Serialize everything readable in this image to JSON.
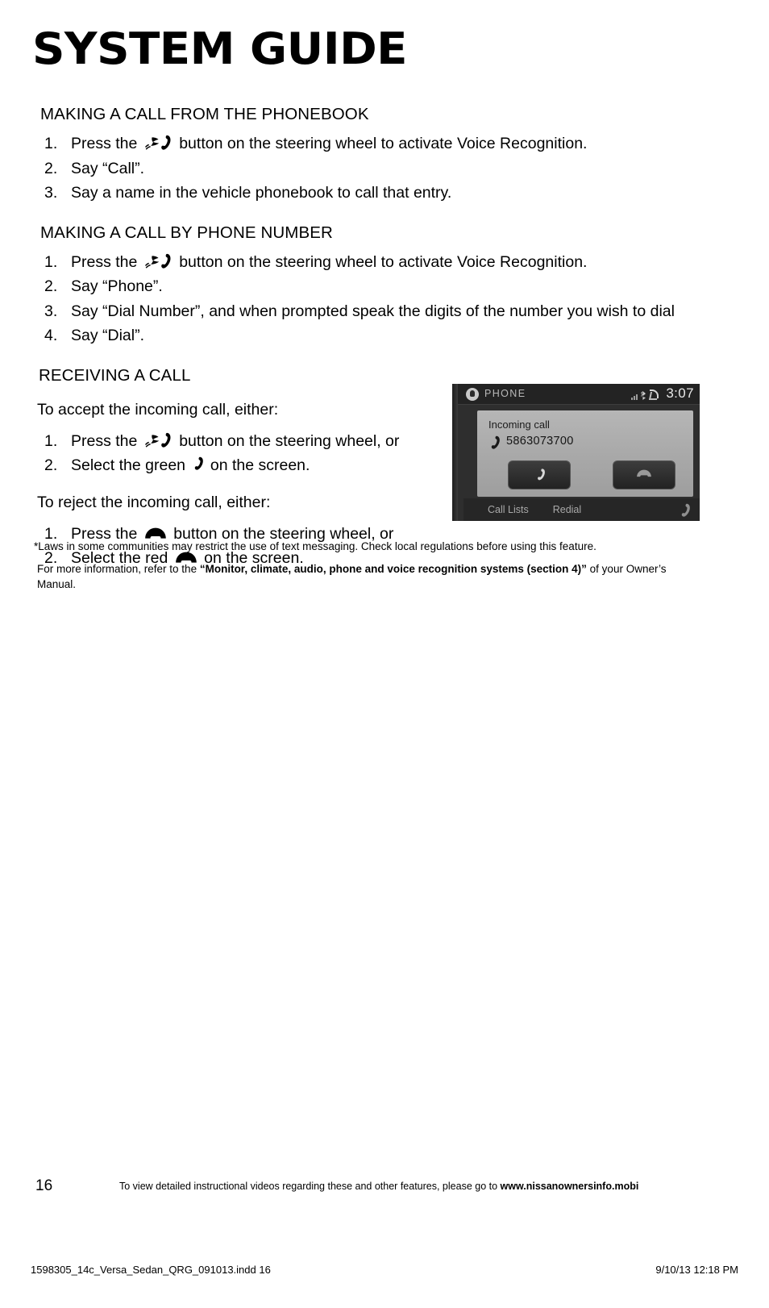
{
  "title": "SYSTEM GUIDE",
  "sections": [
    {
      "heading": "MAKING A CALL FROM THE PHONEBOOK",
      "steps": [
        {
          "num": "1.",
          "before": "Press the ",
          "icon": "talk-phone-icon",
          "after": " button on the steering wheel to activate Voice Recognition."
        },
        {
          "num": "2.",
          "before": "Say “Call”.",
          "icon": "",
          "after": ""
        },
        {
          "num": "3.",
          "before": "Say a name in the vehicle phonebook to call that entry.",
          "icon": "",
          "after": ""
        }
      ]
    },
    {
      "heading": "MAKING A CALL BY PHONE NUMBER",
      "steps": [
        {
          "num": "1.",
          "before": "Press the ",
          "icon": "talk-phone-icon",
          "after": " button on the steering wheel to activate Voice Recognition."
        },
        {
          "num": "2.",
          "before": "Say “Phone”.",
          "icon": "",
          "after": ""
        },
        {
          "num": "3.",
          "before": "Say “Dial Number”, and when prompted speak the digits of the number you wish to dial",
          "icon": "",
          "after": ""
        },
        {
          "num": "4.",
          "before": "Say “Dial”.",
          "icon": "",
          "after": ""
        }
      ]
    }
  ],
  "receiving": {
    "heading": "RECEIVING A CALL",
    "accept_intro": "To accept the incoming call, either:",
    "accept_steps": [
      {
        "num": "1.",
        "before": "Press the ",
        "icon": "talk-phone-icon",
        "after": " button on the steering wheel, or"
      },
      {
        "num": "2.",
        "before": "Select the green ",
        "icon": "handset-offhook-icon",
        "after": " on the screen."
      }
    ],
    "reject_intro": "To reject the incoming call, either:",
    "reject_steps": [
      {
        "num": "1.",
        "before": "Press the ",
        "icon": "handset-onhook-icon",
        "after": " button on the steering wheel, or"
      },
      {
        "num": "2.",
        "before": "Select the red ",
        "icon": "handset-onhook-icon",
        "after": " on the screen."
      }
    ]
  },
  "display": {
    "header_label": "PHONE",
    "header_icon": "phone-round-icon",
    "status_icons": [
      "signal-bars-icon",
      "bluetooth-icon",
      "reception-icon"
    ],
    "clock": "3:07",
    "popup_title": "Incoming call",
    "popup_number": "5863073700",
    "popup_number_icon": "handset-offhook-icon",
    "accept_button_icon": "handset-offhook-icon",
    "reject_button_icon": "handset-onhook-icon",
    "tabs": [
      "Call Lists",
      "Redial"
    ],
    "tab_end_icon": "handset-offhook-icon"
  },
  "footnotes": {
    "line1": "*Laws in some communities may restrict the use of text messaging. Check local regulations before using this feature.",
    "line2_pre": "For more information, refer to the ",
    "line2_bold": "“Monitor, climate, audio, phone and voice recognition systems (section 4)”",
    "line2_post": " of your Owner’s Manual."
  },
  "footer": {
    "page_number": "16",
    "video_note_pre": "To view detailed instructional videos regarding these and other features, please go to ",
    "video_note_url": "www.nissanownersinfo.mobi",
    "slug_left": "1598305_14c_Versa_Sedan_QRG_091013.indd   16",
    "slug_right": "9/10/13   12:18 PM"
  },
  "colors": {
    "text": "#000000",
    "display_bg": "#2e2e2e",
    "display_panel": "#aeaeae"
  }
}
